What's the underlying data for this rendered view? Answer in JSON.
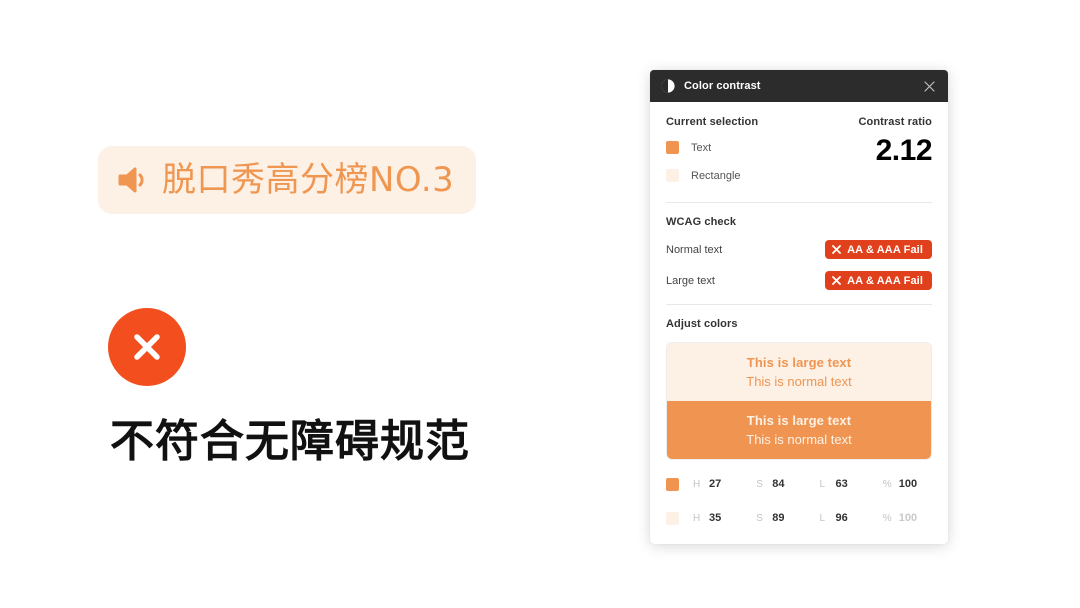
{
  "canvas": {
    "badge": {
      "icon": "speaker-icon",
      "text": "脱口秀高分榜NO.3",
      "background": "#FDF1E6",
      "text_color": "#EF9651"
    },
    "verdict": {
      "icon": "x-circle-icon",
      "icon_color": "#F24E1E",
      "text": "不符合无障碍规范"
    }
  },
  "panel": {
    "header": {
      "icon": "contrast-circle-icon",
      "title": "Color contrast",
      "close_icon": "close-icon"
    },
    "selection": {
      "heading": "Current selection",
      "ratio_heading": "Contrast ratio",
      "ratio_value": "2.12",
      "items": [
        {
          "label": "Text",
          "color": "#EF9551"
        },
        {
          "label": "Rectangle",
          "color": "#FDF1E6"
        }
      ]
    },
    "wcag": {
      "heading": "WCAG check",
      "rows": [
        {
          "label": "Normal text",
          "badge": "AA & AAA Fail",
          "badge_icon": "x-icon",
          "badge_color": "#E0401B"
        },
        {
          "label": "Large text",
          "badge": "AA & AAA Fail",
          "badge_icon": "x-icon",
          "badge_color": "#E0401B"
        }
      ]
    },
    "adjust": {
      "heading": "Adjust colors",
      "preview": [
        {
          "background": "#FDF1E6",
          "text_color": "#EF9551",
          "large_text": "This is large text",
          "normal_text": "This is normal text"
        },
        {
          "background": "#EF9551",
          "text_color": "#FDF1E6",
          "large_text": "This is large text",
          "normal_text": "This is normal text"
        }
      ],
      "color_rows": [
        {
          "swatch": "#EF9551",
          "h_key": "H",
          "h_value": "27",
          "s_key": "S",
          "s_value": "84",
          "l_key": "L",
          "l_value": "63",
          "a_key": "%",
          "a_value": "100",
          "muted": false
        },
        {
          "swatch": "#FDF1E6",
          "h_key": "H",
          "h_value": "35",
          "s_key": "S",
          "s_value": "89",
          "l_key": "L",
          "l_value": "96",
          "a_key": "%",
          "a_value": "100",
          "muted": true
        }
      ]
    }
  }
}
